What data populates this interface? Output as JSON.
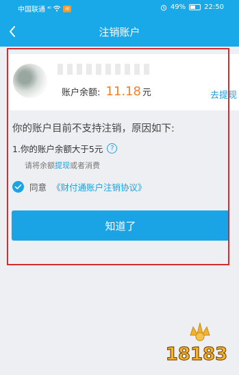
{
  "status_bar": {
    "carrier": "中国联通",
    "signal": "⁴ᴳ",
    "battery": "49%",
    "time": "22:50"
  },
  "nav": {
    "title": "注销账户"
  },
  "account": {
    "balance_label": "账户余额:",
    "balance_value": "11.18",
    "balance_unit": "元",
    "withdraw_label": "去提现"
  },
  "reasons": {
    "title": "你的账户目前不支持注销，原因如下:",
    "item_1": "1.你的账户余额大于5元",
    "hint_prefix": "请将余额",
    "hint_link": "提现",
    "hint_suffix": "或者消费"
  },
  "agreement": {
    "agree_label": "同意",
    "link_text": "《财付通账户注销协议》",
    "checked": true
  },
  "actions": {
    "ok_label": "知道了"
  },
  "watermark": {
    "text": "18183"
  },
  "colors": {
    "header": "#19a8e8",
    "accent": "#1aa4e6",
    "balance": "#f0802a",
    "highlight": "#d42b2b"
  }
}
